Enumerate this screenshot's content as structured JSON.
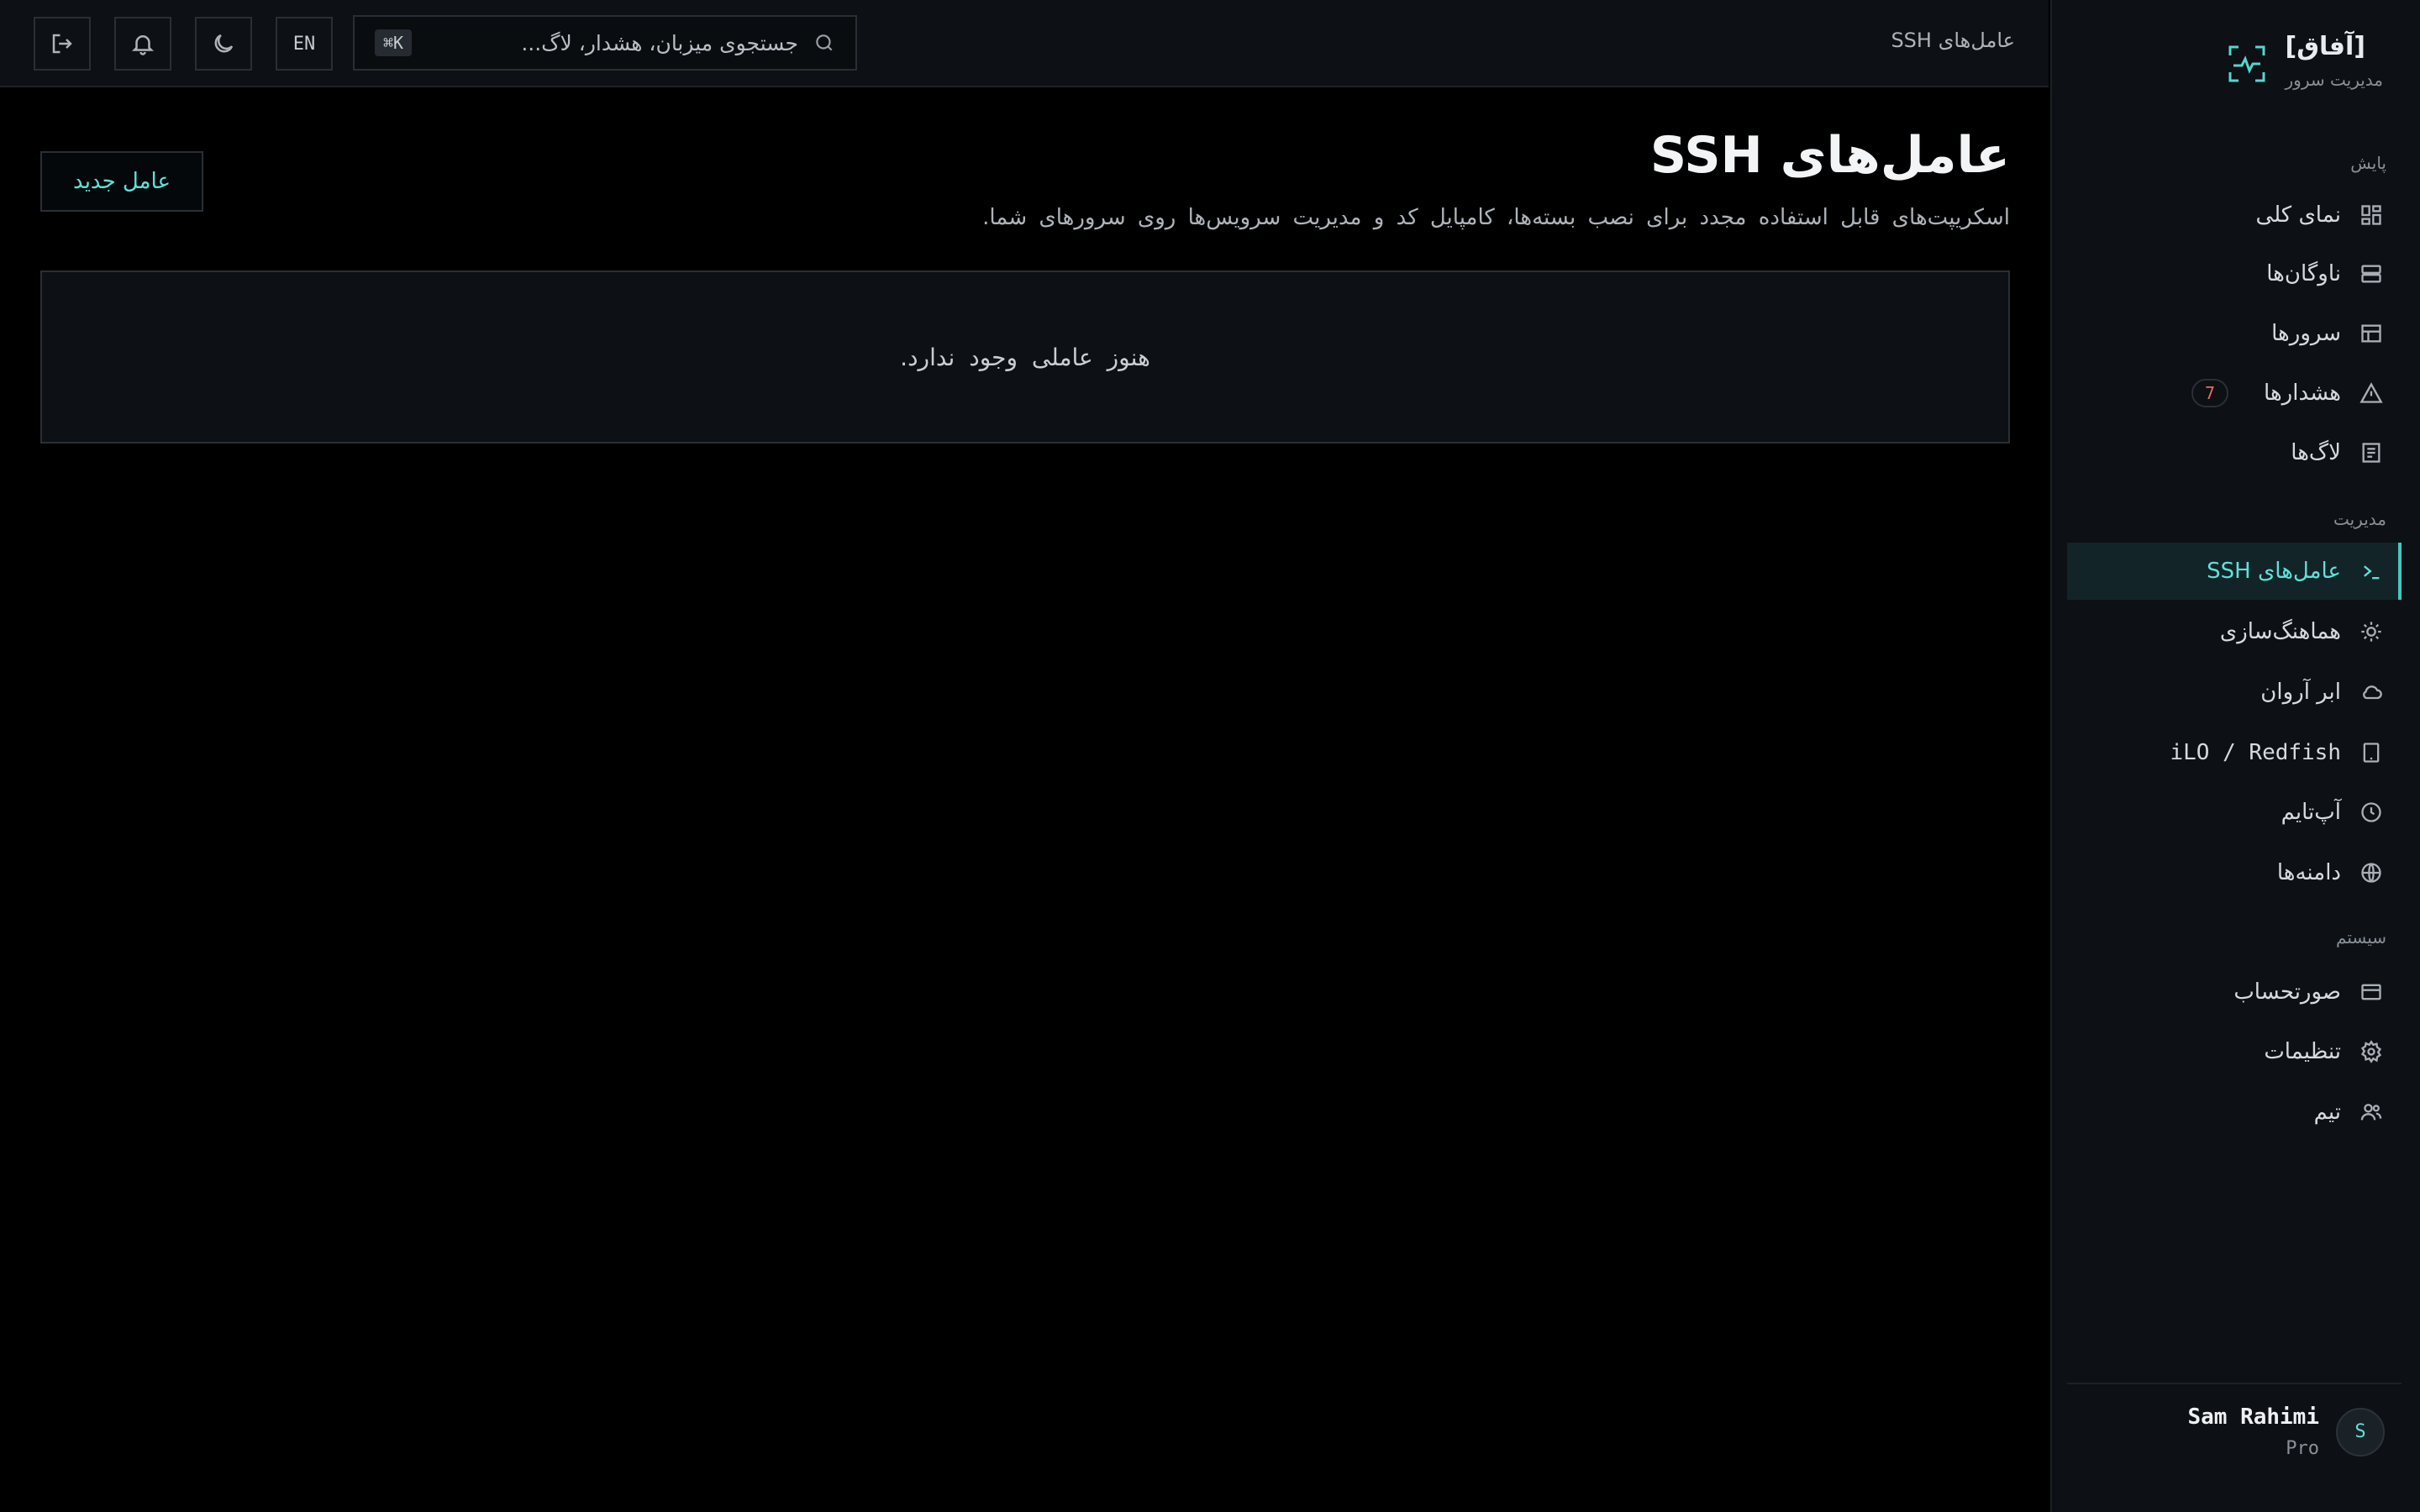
{
  "brand": {
    "name": "[آفاق]",
    "subtitle": "مدیریت سرور"
  },
  "sidebar": {
    "sections": [
      {
        "label": "پایش",
        "items": [
          {
            "label": "نمای کلی",
            "icon": "dashboard-icon"
          },
          {
            "label": "ناوگان‌ها",
            "icon": "server-stack-icon"
          },
          {
            "label": "سرورها",
            "icon": "table-icon"
          },
          {
            "label": "هشدارها",
            "icon": "alert-triangle-icon",
            "badge": "7"
          },
          {
            "label": "لاگ‌ها",
            "icon": "file-text-icon"
          }
        ]
      },
      {
        "label": "مدیریت",
        "items": [
          {
            "label": "عامل‌های SSH",
            "icon": "terminal-icon",
            "active": true
          },
          {
            "label": "هماهنگ‌سازی",
            "icon": "sun-sync-icon"
          },
          {
            "label": "ابر آروان",
            "icon": "cloud-icon"
          },
          {
            "label": "iLO / Redfish",
            "icon": "tablet-icon"
          },
          {
            "label": "آپ‌تایم",
            "icon": "clock-icon"
          },
          {
            "label": "دامنه‌ها",
            "icon": "globe-icon"
          }
        ]
      },
      {
        "label": "سیستم",
        "items": [
          {
            "label": "صورتحساب",
            "icon": "credit-card-icon"
          },
          {
            "label": "تنظیمات",
            "icon": "gear-icon"
          },
          {
            "label": "تیم",
            "icon": "users-icon"
          }
        ]
      }
    ]
  },
  "user": {
    "initial": "S",
    "name": "Sam Rahimi",
    "plan": "Pro"
  },
  "header": {
    "breadcrumb": "عامل‌های SSH",
    "search_placeholder": "جستجوی میزبان، هشدار، لاگ...",
    "shortcut": "⌘K",
    "lang": "EN"
  },
  "main": {
    "title": "عامل‌های SSH",
    "description": "اسکریپت‌های قابل استفاده مجدد برای نصب بسته‌ها، کامپایل کد و مدیریت سرویس‌ها روی سرورهای شما.",
    "new_button": "عامل جدید",
    "empty_text": "هنوز عاملی وجود ندارد."
  },
  "colors": {
    "accent": "#5fe0d8",
    "alert": "#f06a5f",
    "background": "#000000",
    "panel": "#0d1014"
  }
}
